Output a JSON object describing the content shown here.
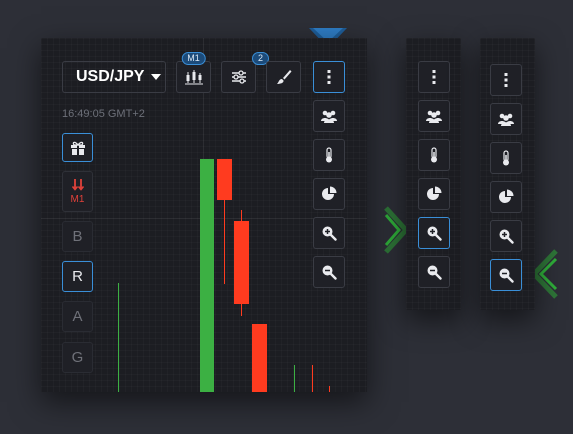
{
  "toolbar": {
    "pair_label": "USD/JPY",
    "chart_type_badge": "M1",
    "indicators_badge": "2"
  },
  "clock": {
    "time": "16:49:05 GMT+2"
  },
  "left_tools": {
    "timeframe_label": "M1",
    "letters": [
      "B",
      "R",
      "A",
      "G"
    ]
  },
  "icons": {
    "menu": "more-vertical-icon",
    "social": "people-icon",
    "sentiment": "thermometer-icon",
    "stats": "pie-chart-icon",
    "zoom_in": "zoom-in-icon",
    "zoom_out": "zoom-out-icon",
    "gift": "gift-icon",
    "signals": "arrows-down-icon",
    "chart_type": "candles-icon",
    "indicators": "sliders-icon",
    "drawing": "brush-icon"
  },
  "colors": {
    "accent": "#3a8fd8",
    "up_candle": "#3cb043",
    "down_candle": "#ff3b1f",
    "pointer_green": "#2fae3a",
    "pointer_blue": "#1e5d99"
  }
}
